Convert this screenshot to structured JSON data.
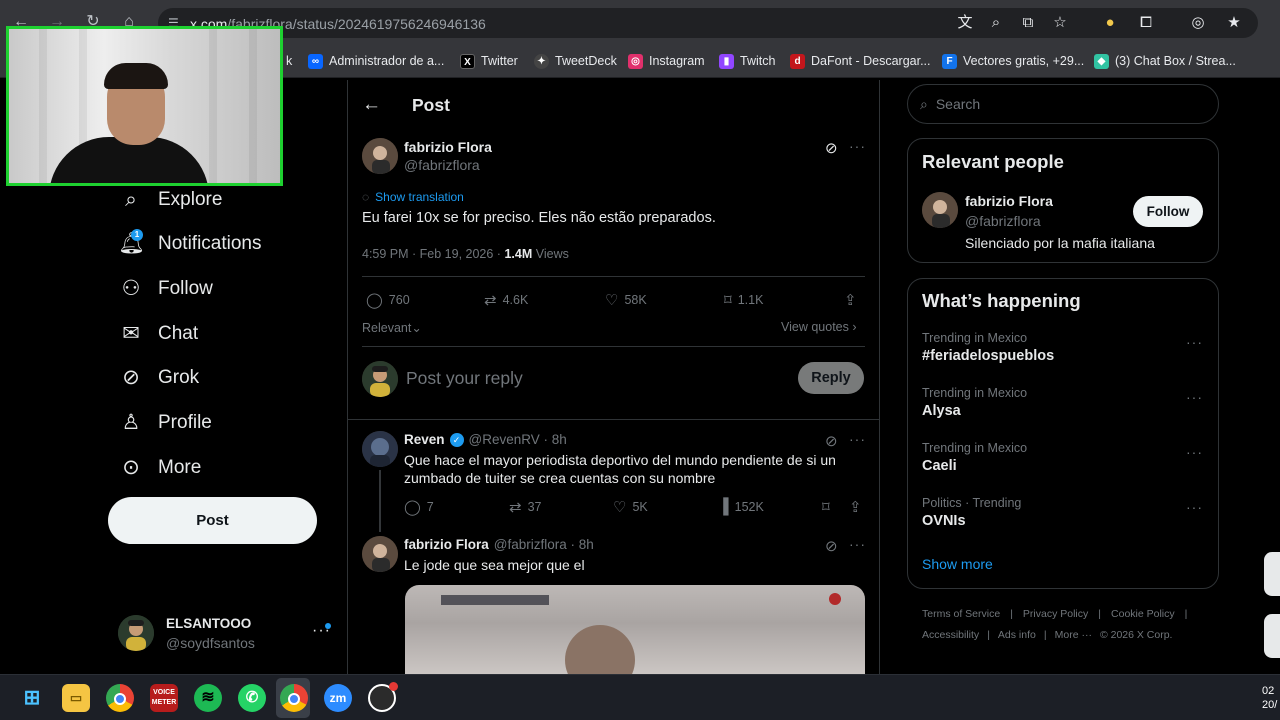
{
  "browser": {
    "url_domain": "x.com",
    "url_path": "/fabrizflora/status/2024619756246946136",
    "bookmarks": [
      {
        "label": "Administrador de a...",
        "icon": "meta-icon",
        "color": "#0866ff"
      },
      {
        "label": "Twitter",
        "icon": "x-icon",
        "color": "#000000"
      },
      {
        "label": "TweetDeck",
        "icon": "tweetdeck-icon",
        "color": "#444444"
      },
      {
        "label": "Instagram",
        "icon": "instagram-icon",
        "color": "#e1306c"
      },
      {
        "label": "Twitch",
        "icon": "twitch-icon",
        "color": "#9146ff"
      },
      {
        "label": "DaFont - Descargar...",
        "icon": "dafont-icon",
        "color": "#c4161c"
      },
      {
        "label": "Vectores gratis, +29...",
        "icon": "freepik-icon",
        "color": "#1273eb"
      },
      {
        "label": "(3) Chat Box / Strea...",
        "icon": "streamlabs-icon",
        "color": "#31c3a2"
      }
    ],
    "bookmark_partial": "k"
  },
  "sidebar": {
    "items": [
      {
        "label": "Explore",
        "icon": "search-icon"
      },
      {
        "label": "Notifications",
        "icon": "bell-icon",
        "badge": "1"
      },
      {
        "label": "Follow",
        "icon": "add-person-icon"
      },
      {
        "label": "Chat",
        "icon": "mail-icon"
      },
      {
        "label": "Grok",
        "icon": "grok-icon"
      },
      {
        "label": "Profile",
        "icon": "person-icon"
      },
      {
        "label": "More",
        "icon": "more-circle-icon"
      }
    ],
    "post_button": "Post",
    "account": {
      "name": "ELSANTOOO",
      "handle": "@soydfsantos"
    }
  },
  "header": {
    "title": "Post"
  },
  "main_post": {
    "author": "fabrizio Flora",
    "handle": "@fabrizflora",
    "show_translation": "Show translation",
    "text": "Eu farei 10x se for preciso. Eles não estão preparados.",
    "timestamp": "4:59 PM · Feb 19, 2026 · ",
    "views_count": "1.4M",
    "views_label": " Views",
    "replies": "760",
    "reposts": "4.6K",
    "likes": "58K",
    "bookmarks": "1.1K",
    "sort_label": "Relevant",
    "view_quotes": "View quotes"
  },
  "composer": {
    "placeholder": "Post your reply",
    "button": "Reply"
  },
  "replies": [
    {
      "author": "Reven",
      "handle": "@RevenRV · 8h",
      "verified": true,
      "text": "Que hace el mayor periodista deportivo del mundo pendiente de si un zumbado de tuiter se crea cuentas con su nombre",
      "replies": "7",
      "reposts": "37",
      "likes": "5K",
      "views": "152K"
    },
    {
      "author": "fabrizio Flora",
      "handle": "@fabrizflora · 8h",
      "text": "Le jode que sea mejor que el"
    }
  ],
  "search": {
    "placeholder": "Search"
  },
  "relevant_people": {
    "title": "Relevant people",
    "person": {
      "name": "fabrizio Flora",
      "handle": "@fabrizflora",
      "bio": "Silenciado por la mafia italiana",
      "button": "Follow"
    }
  },
  "whats_happening": {
    "title": "What’s happening",
    "trends": [
      {
        "category": "Trending in Mexico",
        "name": "#feriadelospueblos"
      },
      {
        "category": "Trending in Mexico",
        "name": "Alysa"
      },
      {
        "category": "Trending in Mexico",
        "name": "Caeli"
      },
      {
        "category": "Politics · Trending",
        "name": "OVNIs"
      }
    ],
    "show_more": "Show more"
  },
  "footer_links": [
    "Terms of Service",
    "Privacy Policy",
    "Cookie Policy",
    "Accessibility",
    "Ads info",
    "More ···",
    "© 2026 X Corp."
  ],
  "taskbar": {
    "clock_line1": "02",
    "clock_line2": "20/"
  }
}
